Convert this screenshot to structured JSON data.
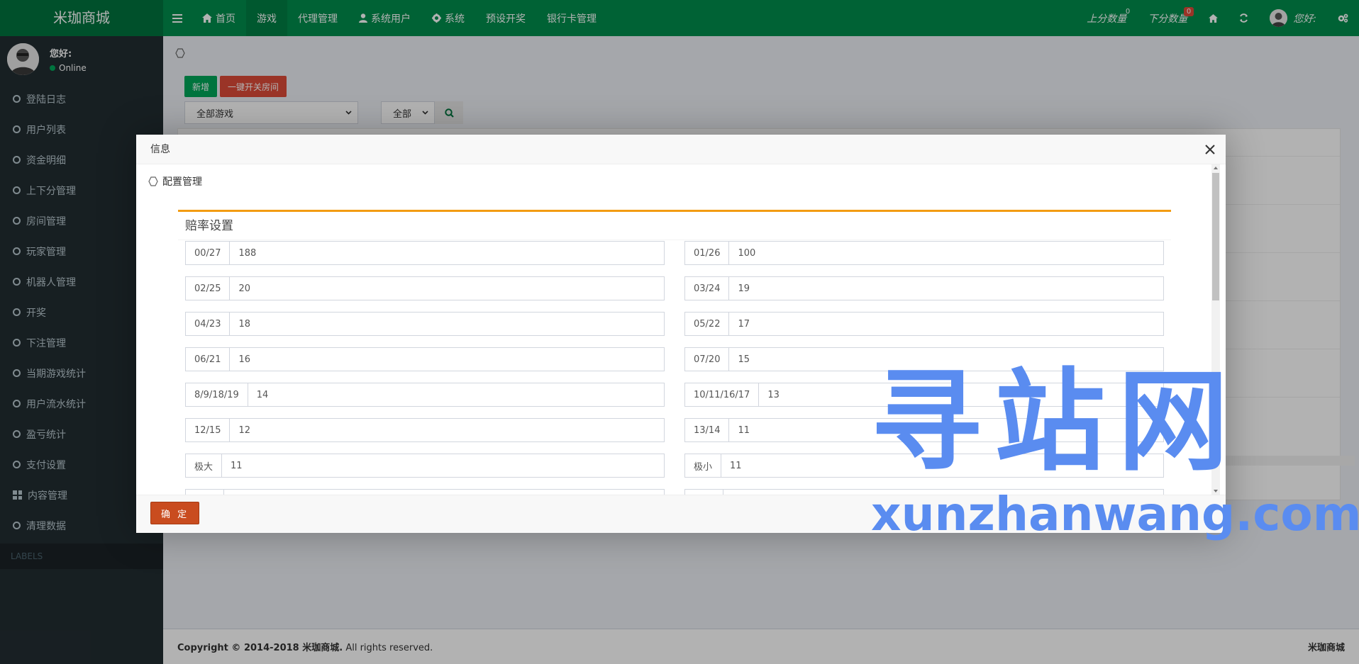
{
  "header": {
    "logo": "米珈商城",
    "nav": [
      {
        "label": "首页",
        "icon": "home-icon"
      },
      {
        "label": "游戏",
        "icon": ""
      },
      {
        "label": "代理管理",
        "icon": ""
      },
      {
        "label": "系统用户",
        "icon": "user-icon"
      },
      {
        "label": "系统",
        "icon": "gear-icon"
      },
      {
        "label": "预设开奖",
        "icon": ""
      },
      {
        "label": "银行卡管理",
        "icon": ""
      }
    ],
    "up_count_label": "上分数量",
    "up_count": "0",
    "down_count_label": "下分数量",
    "down_count": "0",
    "greeting": "您好:"
  },
  "sidebar": {
    "user_name": "您好:",
    "status": "Online",
    "items": [
      {
        "label": "登陆日志"
      },
      {
        "label": "用户列表"
      },
      {
        "label": "资金明细"
      },
      {
        "label": "上下分管理"
      },
      {
        "label": "房间管理"
      },
      {
        "label": "玩家管理"
      },
      {
        "label": "机器人管理"
      },
      {
        "label": "开奖"
      },
      {
        "label": "下注管理"
      },
      {
        "label": "当期游戏统计"
      },
      {
        "label": "用户流水统计"
      },
      {
        "label": "盈亏统计"
      },
      {
        "label": "支付设置"
      },
      {
        "label": "内容管理"
      },
      {
        "label": "清理数据"
      }
    ],
    "labels_header": "LABELS"
  },
  "content": {
    "btn_new": "新增",
    "btn_room": "一键开关房间",
    "game_select": "全部游戏",
    "status_select": "全部"
  },
  "modal": {
    "title": "信息",
    "section_title": "配置管理",
    "panel_title": "赔率设置",
    "fields": [
      {
        "label": "00/27",
        "value": "188"
      },
      {
        "label": "01/26",
        "value": "100"
      },
      {
        "label": "02/25",
        "value": "20"
      },
      {
        "label": "03/24",
        "value": "19"
      },
      {
        "label": "04/23",
        "value": "18"
      },
      {
        "label": "05/22",
        "value": "17"
      },
      {
        "label": "06/21",
        "value": "16"
      },
      {
        "label": "07/20",
        "value": "15"
      },
      {
        "label": "8/9/18/19",
        "value": "14"
      },
      {
        "label": "10/11/16/17",
        "value": "13"
      },
      {
        "label": "12/15",
        "value": "12"
      },
      {
        "label": "13/14",
        "value": "11"
      },
      {
        "label": "极大",
        "value": "11"
      },
      {
        "label": "极小",
        "value": "11"
      },
      {
        "label": "",
        "value": ""
      },
      {
        "label": "",
        "value": ""
      }
    ],
    "confirm": "确 定"
  },
  "footer": {
    "copyright_prefix": "Copyright © 2014-2018 ",
    "brand": "米珈商城.",
    "rights": " All rights reserved.",
    "right_brand": "米珈商城"
  },
  "watermark": {
    "cn": "寻站网",
    "en": "xunzhanwang.com"
  }
}
